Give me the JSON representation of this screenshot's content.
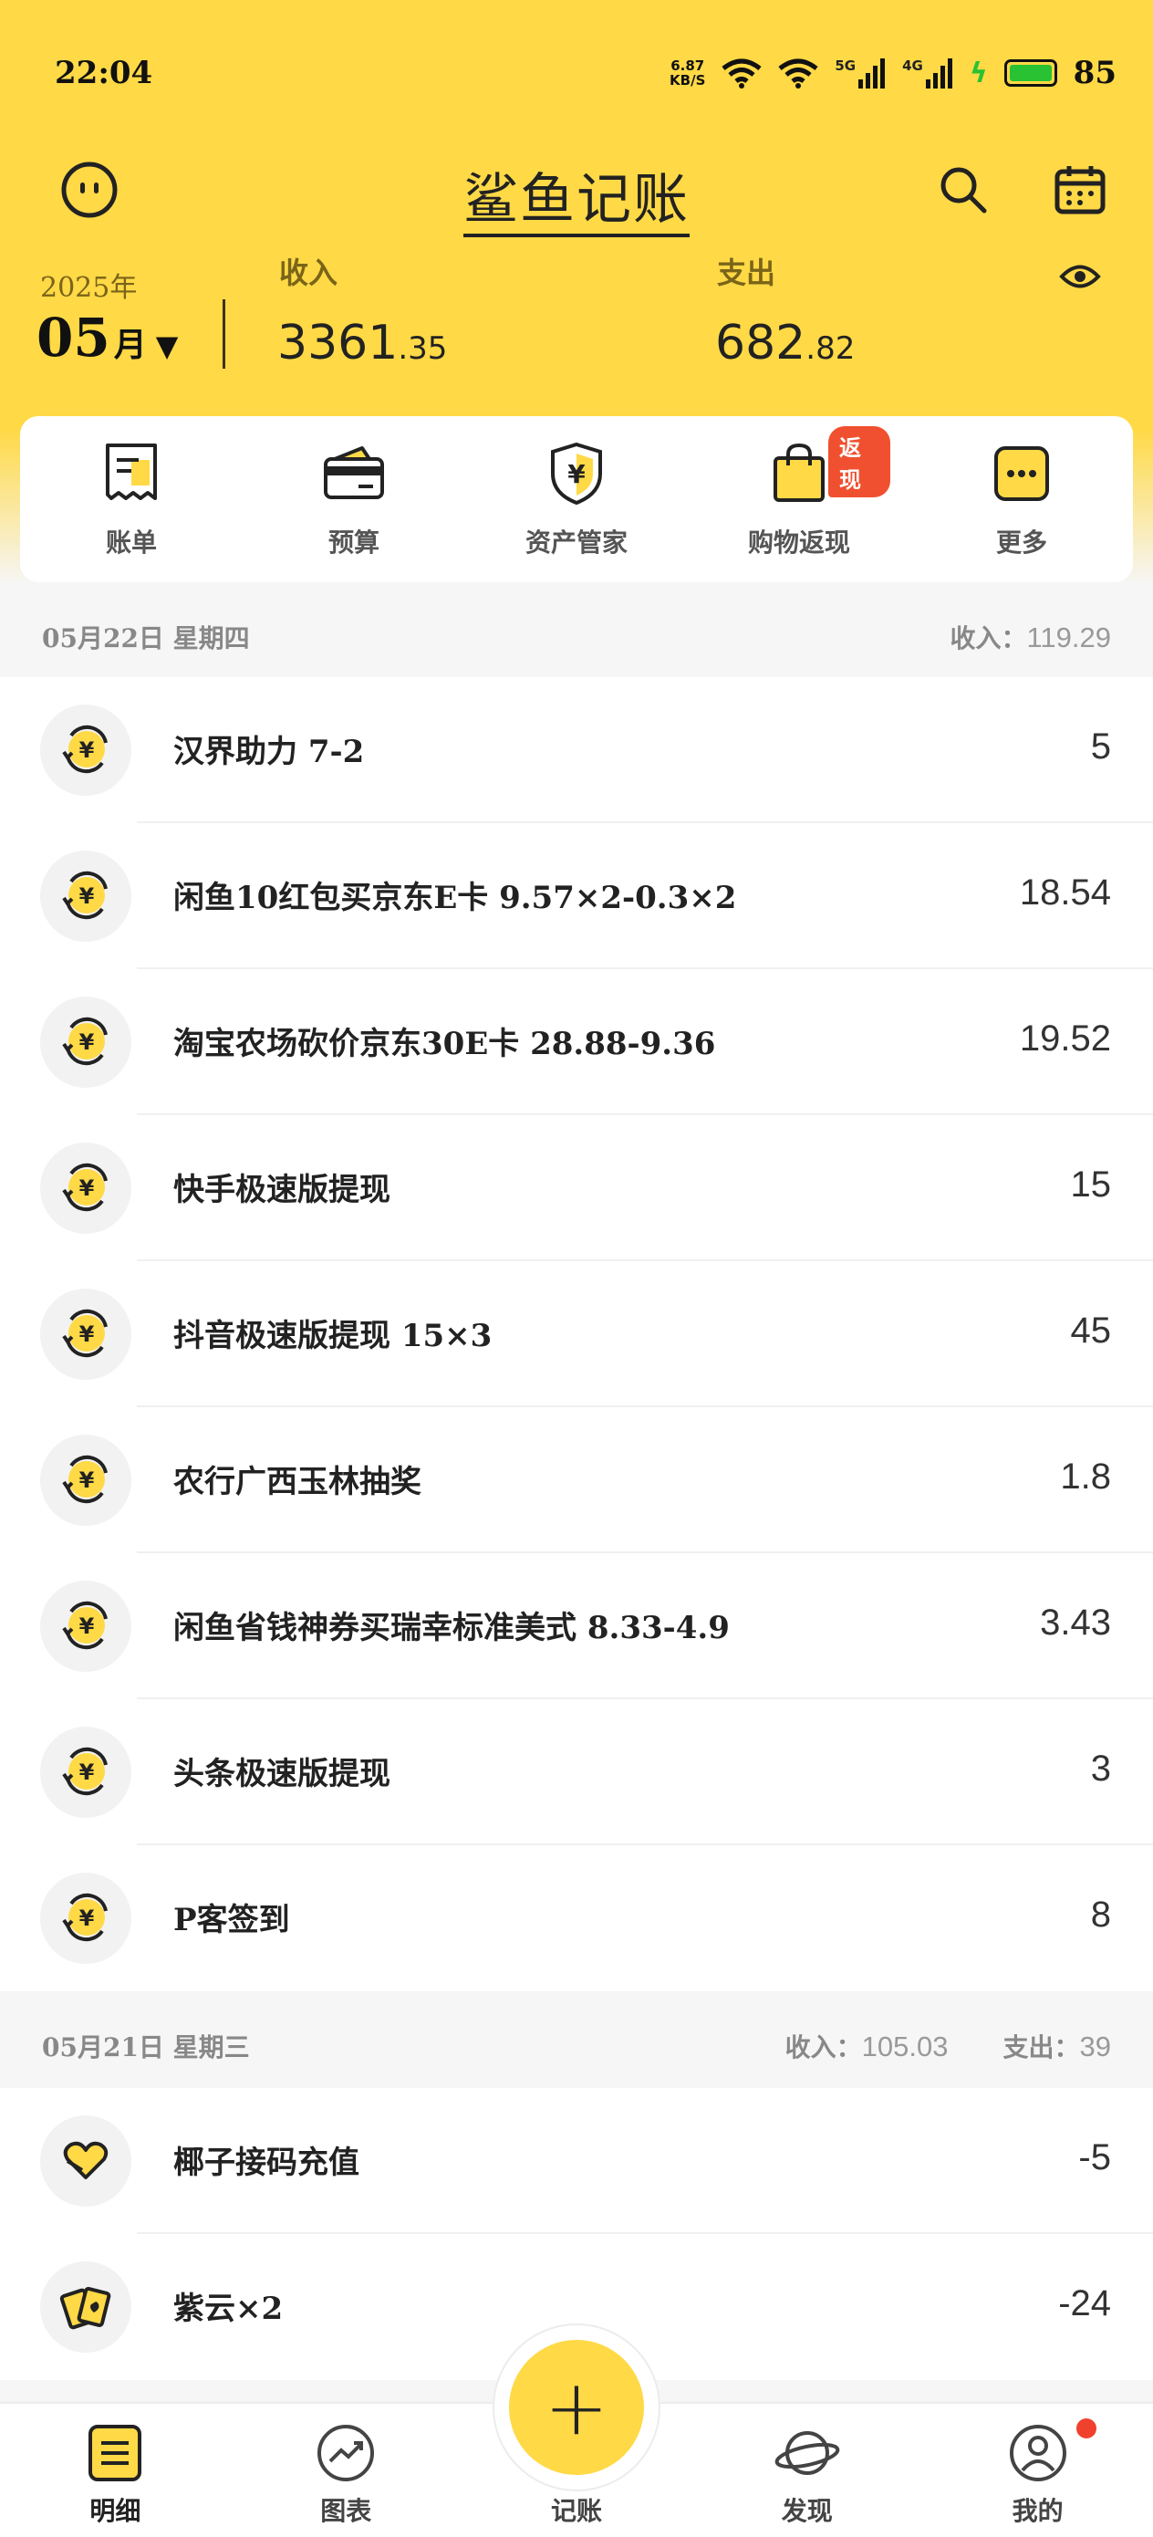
{
  "status_bar": {
    "time": "22:04",
    "net_speed": "6.87",
    "net_unit": "KB/S",
    "sig1": "5G",
    "sig2": "4G",
    "battery": "85",
    "battery_color": "#29c232"
  },
  "header": {
    "title": "鲨鱼记账",
    "left_icon": "face-icon",
    "right_icons": [
      "search-icon",
      "calendar-icon"
    ]
  },
  "summary": {
    "year": "2025年",
    "month": "05",
    "month_suffix": "月",
    "caret": "▼",
    "income_label": "收入",
    "income_int": "3361",
    "income_dec": ".35",
    "expense_label": "支出",
    "expense_int": "682",
    "expense_dec": ".82"
  },
  "shortcuts": [
    {
      "label": "账单",
      "icon": "bill-icon"
    },
    {
      "label": "预算",
      "icon": "wallet-icon"
    },
    {
      "label": "资产管家",
      "icon": "shield-yen-icon"
    },
    {
      "label": "购物返现",
      "icon": "shopping-bag-icon",
      "badge": "返现"
    },
    {
      "label": "更多",
      "icon": "more-icon"
    }
  ],
  "days": [
    {
      "date": "05月22日 星期四",
      "income_label": "收入：",
      "income": "119.29",
      "items": [
        {
          "name": "汉界助力 7-2",
          "amount": "5",
          "icon": "yen-coin-icon"
        },
        {
          "name": "闲鱼10红包买京东E卡 9.57×2-0.3×2",
          "amount": "18.54",
          "icon": "yen-coin-icon"
        },
        {
          "name": "淘宝农场砍价京东30E卡 28.88-9.36",
          "amount": "19.52",
          "icon": "yen-coin-icon"
        },
        {
          "name": "快手极速版提现",
          "amount": "15",
          "icon": "yen-coin-icon"
        },
        {
          "name": "抖音极速版提现 15×3",
          "amount": "45",
          "icon": "yen-coin-icon"
        },
        {
          "name": "农行广西玉林抽奖",
          "amount": "1.8",
          "icon": "yen-coin-icon"
        },
        {
          "name": "闲鱼省钱神券买瑞幸标准美式 8.33-4.9",
          "amount": "3.43",
          "icon": "yen-coin-icon"
        },
        {
          "name": "头条极速版提现",
          "amount": "3",
          "icon": "yen-coin-icon"
        },
        {
          "name": "P客签到",
          "amount": "8",
          "icon": "yen-coin-icon"
        }
      ]
    },
    {
      "date": "05月21日 星期三",
      "income_label": "收入：",
      "income": "105.03",
      "expense_label": "支出：",
      "expense": "39",
      "items": [
        {
          "name": "椰子接码充值",
          "amount": "-5",
          "icon": "heart-hand-icon"
        },
        {
          "name": "紫云×2",
          "amount": "-24",
          "icon": "cards-icon"
        }
      ]
    }
  ],
  "nav": [
    {
      "label": "明细",
      "icon": "list-icon"
    },
    {
      "label": "图表",
      "icon": "chart-icon"
    },
    {
      "label": "记账",
      "icon": "plus-icon"
    },
    {
      "label": "发现",
      "icon": "planet-icon"
    },
    {
      "label": "我的",
      "icon": "user-icon"
    }
  ],
  "colors": {
    "brand_yellow": "#ffd946",
    "badge_red": "#f0502f"
  }
}
